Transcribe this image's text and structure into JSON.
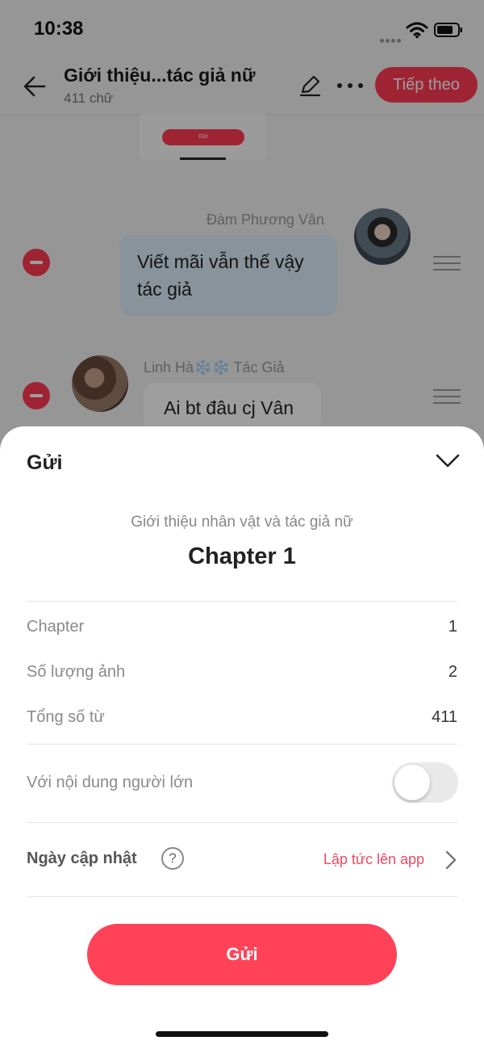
{
  "status_bar": {
    "time": "10:38"
  },
  "nav": {
    "title": "Giới thiệu...tác giả nữ",
    "word_count": "411 chữ",
    "next_label": "Tiếp theo"
  },
  "chat": {
    "preview_button": "Gửi",
    "messages": [
      {
        "sender": "Đàm Phương Vân",
        "text": "Viết mãi vẫn thế vậy tác giả"
      },
      {
        "sender": "Linh Hà❄️❄️ Tác Giả",
        "text": "Ai bt đâu cj Vân"
      }
    ]
  },
  "sheet": {
    "title": "Gửi",
    "story_title": "Giới thiệu nhân vật và tác giả nữ",
    "chapter_title": "Chapter 1",
    "rows": [
      {
        "label": "Chapter",
        "value": "1"
      },
      {
        "label": "Số lượng ảnh",
        "value": "2"
      },
      {
        "label": "Tổng số từ",
        "value": "411"
      }
    ],
    "adult_label": "Với nội dung người lớn",
    "adult_enabled": false,
    "date_label": "Ngày cập nhật",
    "help_symbol": "?",
    "date_value": "Lập tức lên app",
    "send_label": "Gửi"
  },
  "colors": {
    "accent": "#ff3b55",
    "link": "#f24862"
  }
}
